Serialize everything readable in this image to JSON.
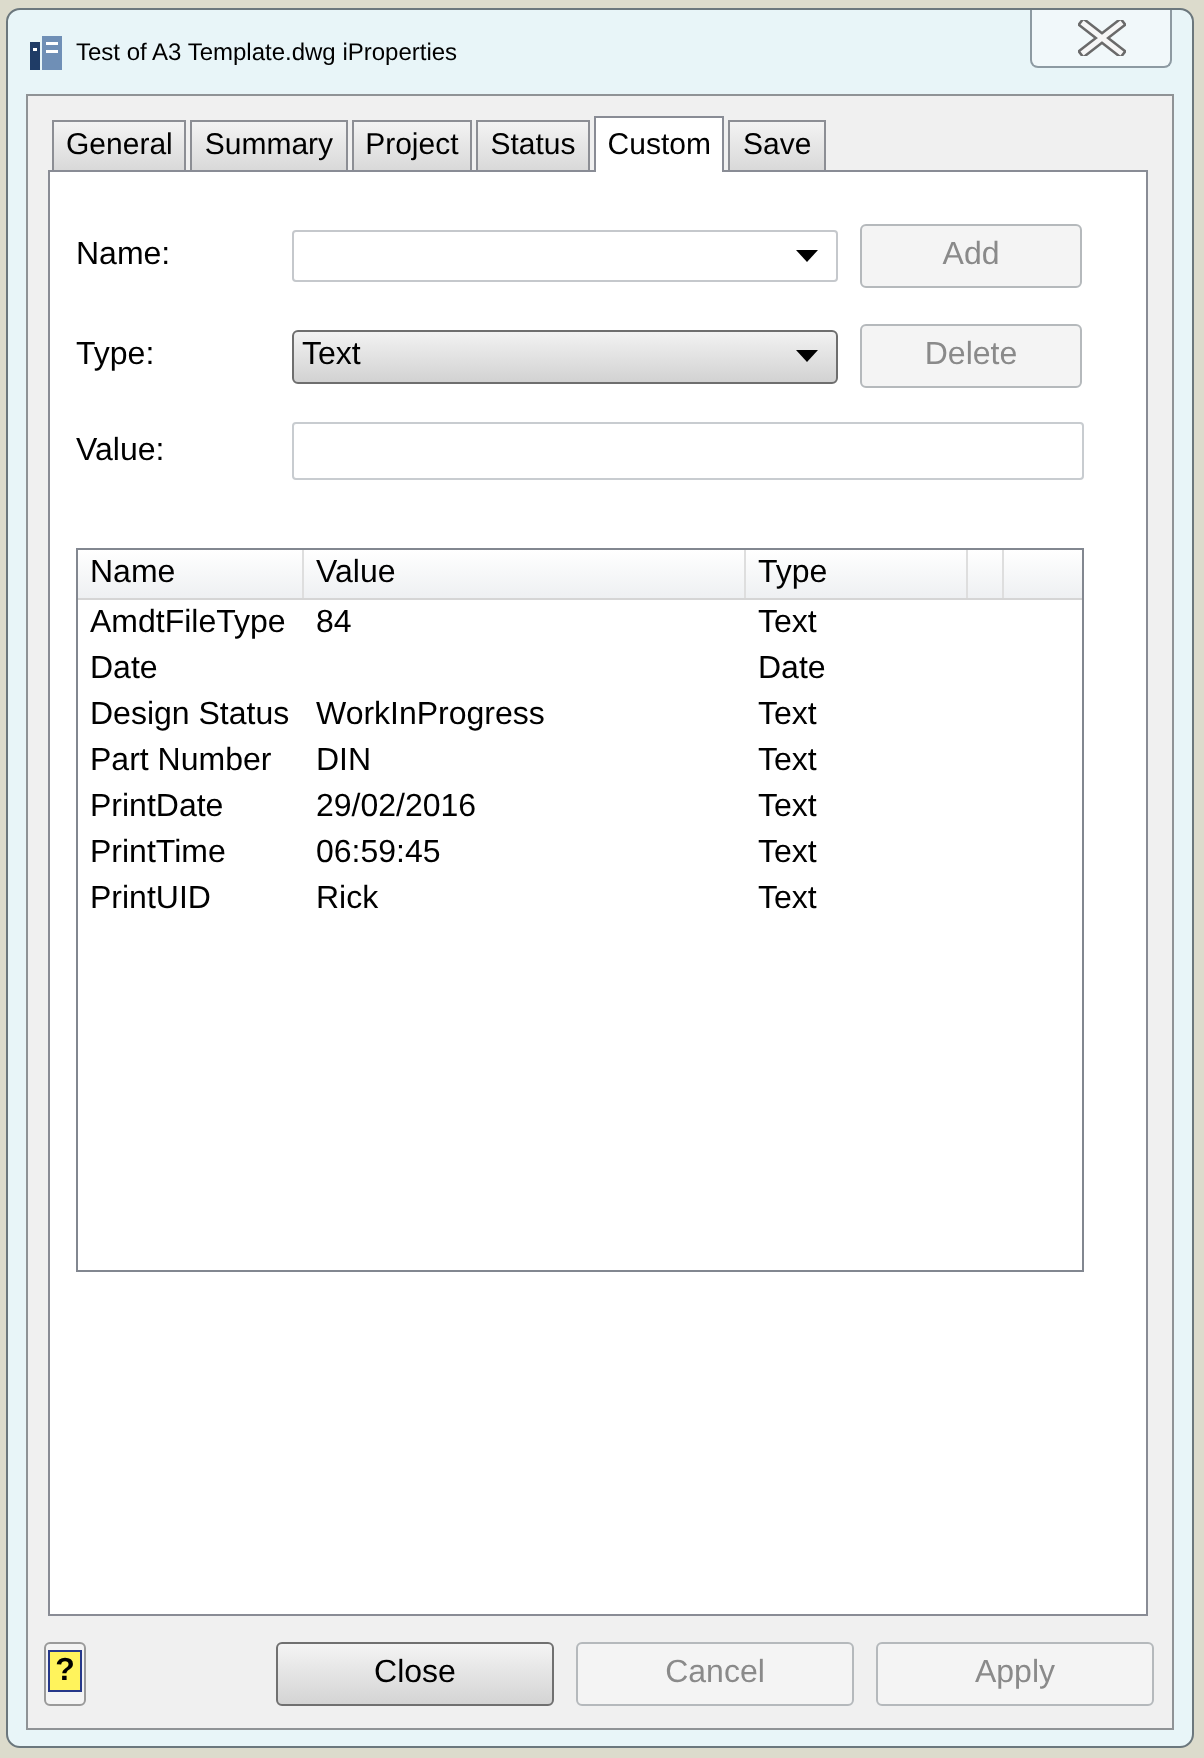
{
  "window": {
    "title": "Test of A3 Template.dwg iProperties"
  },
  "tabs": [
    {
      "label": "General",
      "selected": false
    },
    {
      "label": "Summary",
      "selected": false
    },
    {
      "label": "Project",
      "selected": false
    },
    {
      "label": "Status",
      "selected": false
    },
    {
      "label": "Custom",
      "selected": true
    },
    {
      "label": "Save",
      "selected": false
    }
  ],
  "form": [
    {
      "kind": "combo",
      "label": "Name:",
      "button": {
        "label": "Add",
        "disabled": true
      }
    },
    {
      "kind": "dropdown",
      "label": "Type:",
      "value": "Text",
      "button": {
        "label": "Delete",
        "disabled": true
      }
    },
    {
      "kind": "text",
      "label": "Value:"
    }
  ],
  "table": {
    "columns": [
      "Name",
      "Value",
      "Type"
    ],
    "rows": [
      {
        "name": "AmdtFileType",
        "value": "84",
        "type": "Text"
      },
      {
        "name": "Date",
        "type": "Date"
      },
      {
        "name": "Design Status",
        "value": "WorkInProgress",
        "type": "Text"
      },
      {
        "name": "Part Number",
        "value": "DIN",
        "type": "Text"
      },
      {
        "name": "PrintDate",
        "value": "29/02/2016",
        "type": "Text"
      },
      {
        "name": "PrintTime",
        "value": "06:59:45",
        "type": "Text"
      },
      {
        "name": "PrintUID",
        "value": "Rick",
        "type": "Text"
      }
    ]
  },
  "help_button": {
    "label": "?"
  },
  "buttons": [
    {
      "label": "Close",
      "disabled": false
    },
    {
      "label": "Cancel",
      "disabled": true
    },
    {
      "label": "Apply",
      "disabled": true
    }
  ]
}
